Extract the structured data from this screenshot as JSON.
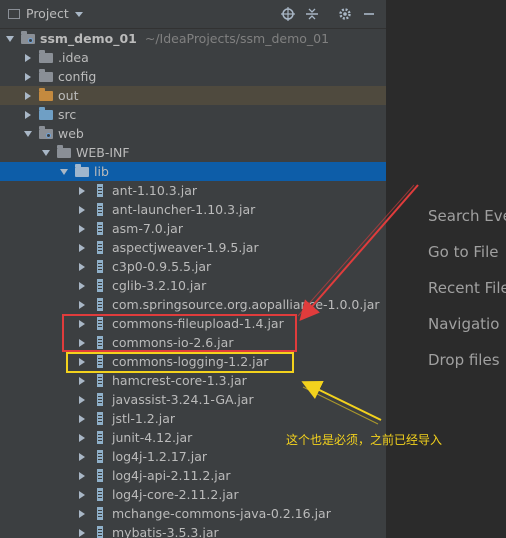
{
  "header": {
    "title": "Project",
    "icons": [
      "dropdown-icon",
      "locate-icon",
      "collapse-icon",
      "gear-icon",
      "hide-icon"
    ]
  },
  "tree": [
    {
      "label": "ssm_demo_01",
      "path": "~/IdeaProjects/ssm_demo_01",
      "level": 0,
      "expanded": true,
      "icon": "module"
    },
    {
      "label": ".idea",
      "level": 1,
      "expanded": false,
      "icon": "folder"
    },
    {
      "label": "config",
      "level": 1,
      "expanded": false,
      "icon": "folder"
    },
    {
      "label": "out",
      "level": 1,
      "expanded": false,
      "icon": "folder-orange",
      "highlighted": true
    },
    {
      "label": "src",
      "level": 1,
      "expanded": false,
      "icon": "folder-blue"
    },
    {
      "label": "web",
      "level": 1,
      "expanded": true,
      "icon": "folder-web"
    },
    {
      "label": "WEB-INF",
      "level": 2,
      "expanded": true,
      "icon": "folder"
    },
    {
      "label": "lib",
      "level": 3,
      "expanded": true,
      "icon": "folder-light",
      "selected": true
    },
    {
      "label": "ant-1.10.3.jar",
      "level": 4,
      "icon": "jar"
    },
    {
      "label": "ant-launcher-1.10.3.jar",
      "level": 4,
      "icon": "jar"
    },
    {
      "label": "asm-7.0.jar",
      "level": 4,
      "icon": "jar"
    },
    {
      "label": "aspectjweaver-1.9.5.jar",
      "level": 4,
      "icon": "jar"
    },
    {
      "label": "c3p0-0.9.5.5.jar",
      "level": 4,
      "icon": "jar"
    },
    {
      "label": "cglib-3.2.10.jar",
      "level": 4,
      "icon": "jar"
    },
    {
      "label": "com.springsource.org.aopalliance-1.0.0.jar",
      "level": 4,
      "icon": "jar"
    },
    {
      "label": "commons-fileupload-1.4.jar",
      "level": 4,
      "icon": "jar"
    },
    {
      "label": "commons-io-2.6.jar",
      "level": 4,
      "icon": "jar"
    },
    {
      "label": "commons-logging-1.2.jar",
      "level": 4,
      "icon": "jar"
    },
    {
      "label": "hamcrest-core-1.3.jar",
      "level": 4,
      "icon": "jar"
    },
    {
      "label": "javassist-3.24.1-GA.jar",
      "level": 4,
      "icon": "jar"
    },
    {
      "label": "jstl-1.2.jar",
      "level": 4,
      "icon": "jar"
    },
    {
      "label": "junit-4.12.jar",
      "level": 4,
      "icon": "jar"
    },
    {
      "label": "log4j-1.2.17.jar",
      "level": 4,
      "icon": "jar"
    },
    {
      "label": "log4j-api-2.11.2.jar",
      "level": 4,
      "icon": "jar"
    },
    {
      "label": "log4j-core-2.11.2.jar",
      "level": 4,
      "icon": "jar"
    },
    {
      "label": "mchange-commons-java-0.2.16.jar",
      "level": 4,
      "icon": "jar"
    },
    {
      "label": "mybatis-3.5.3.jar",
      "level": 4,
      "icon": "jar"
    }
  ],
  "editor_hints": [
    "Search Eve",
    "Go to File",
    "Recent File",
    "Navigatio",
    "Drop files"
  ],
  "annotation": {
    "note": "这个也是必须，之前已经导入",
    "colors": {
      "red": "#e03c3c",
      "yellow": "#f3d21d"
    }
  }
}
